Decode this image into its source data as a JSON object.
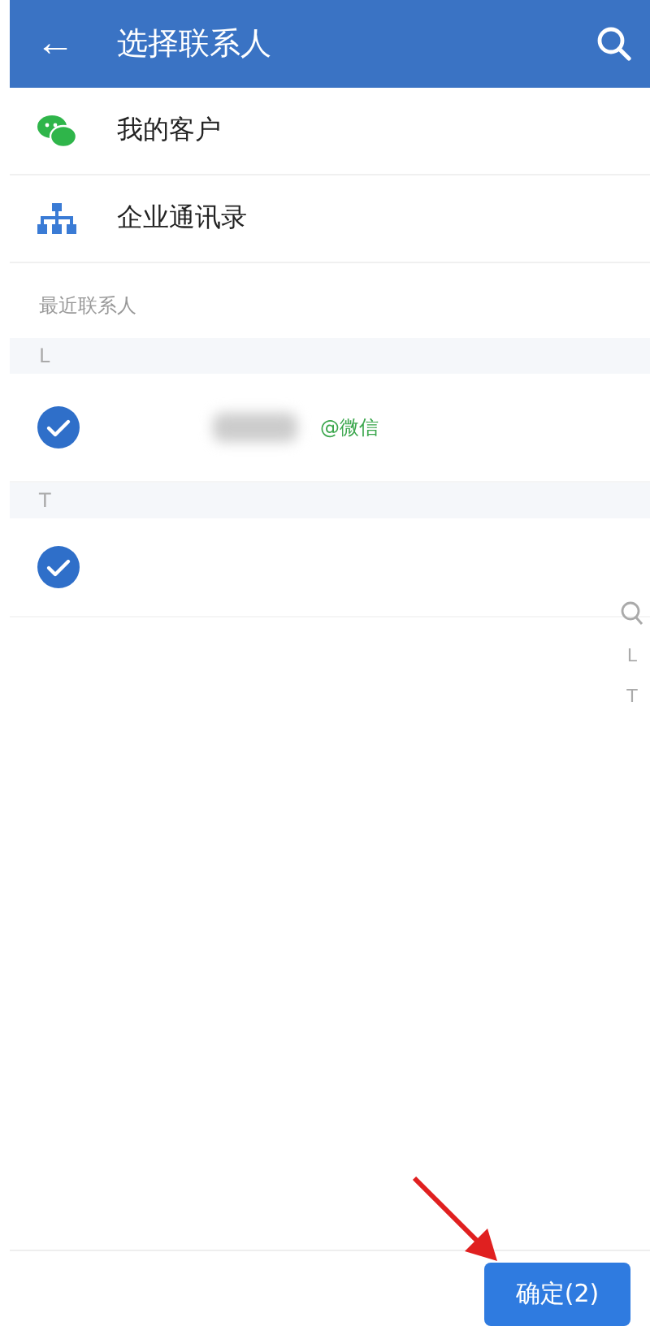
{
  "header": {
    "back": "←",
    "title": "选择联系人"
  },
  "entries": [
    {
      "kind": "wechat",
      "label": "我的客户"
    },
    {
      "kind": "org",
      "label": "企业通讯录"
    }
  ],
  "recent_title": "最近联系人",
  "groups": [
    {
      "letter": "L",
      "contacts": [
        {
          "checked": true,
          "name_blurred": true,
          "source": "@微信"
        }
      ]
    },
    {
      "letter": "T",
      "contacts": [
        {
          "checked": true,
          "name_blurred": false
        }
      ]
    }
  ],
  "index": [
    "L",
    "T"
  ],
  "confirm_button": "确定(2)"
}
